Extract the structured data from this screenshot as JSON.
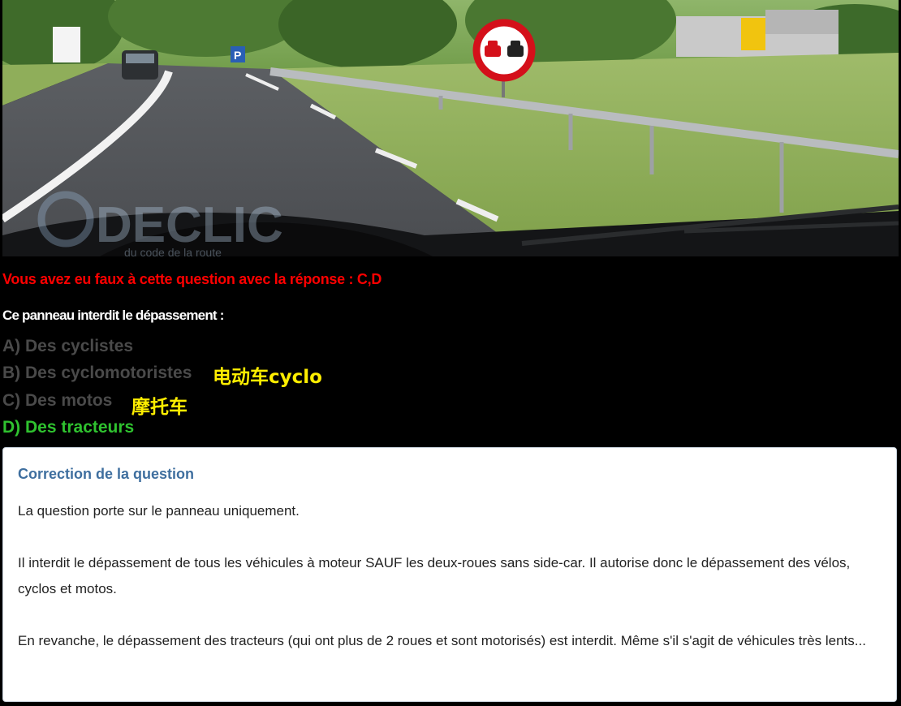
{
  "photo": {
    "description_icon": "road-sign-no-overtaking-icon",
    "watermark_text": "CODE CLIC",
    "watermark_sub": "du code de la route",
    "parking_sign": "P"
  },
  "result_message": "Vous avez eu faux à cette question avec la réponse : C,D",
  "question": "Ce panneau interdit le dépassement :",
  "answers": [
    {
      "label": "A) Des cyclistes",
      "state": "wrong"
    },
    {
      "label": "B) Des cyclomotoristes",
      "state": "wrong"
    },
    {
      "label": "C) Des motos",
      "state": "wrong"
    },
    {
      "label": "D) Des tracteurs",
      "state": "correct"
    }
  ],
  "annotations": {
    "b_note": "电动车cyclo",
    "c_note": "摩托车"
  },
  "correction": {
    "title": "Correction de la question",
    "paragraphs": [
      "La question porte sur le panneau uniquement.",
      "Il interdit le dépassement de tous les véhicules à moteur SAUF les deux-roues sans side-car. Il autorise donc le dépassement des vélos, cyclos et motos.",
      "En revanche, le dépassement des tracteurs (qui ont plus de 2 roues et sont motorisés) est interdit. Même s'il s'agit de véhicules très lents..."
    ]
  },
  "colors": {
    "wrong": "#ff0000",
    "correct": "#2fc22f",
    "dimmed": "#4a4a4a",
    "note": "#ffee00",
    "title": "#3f6f9f"
  }
}
